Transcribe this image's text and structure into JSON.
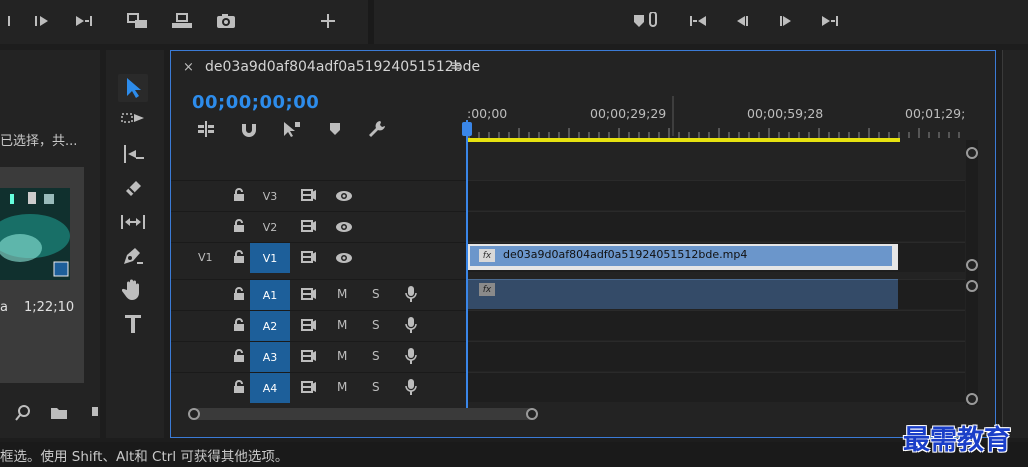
{
  "sequence": {
    "tab_title": "de03a9d0af804adf0a51924051512bde",
    "tab_close": "×",
    "tab_menu": "≡",
    "timecode": "00;00;00;00",
    "ruler_labels": [
      ":00;00",
      "00;00;29;29",
      "00;00;59;28",
      "00;01;29;"
    ]
  },
  "project": {
    "truncated_text": "已选择，共...",
    "clip_name": "a",
    "clip_duration": "1;22;10"
  },
  "tracks": {
    "video": [
      {
        "label": "V3",
        "source": ""
      },
      {
        "label": "V2",
        "source": ""
      },
      {
        "label": "V1",
        "source": "V1"
      }
    ],
    "audio": [
      {
        "label": "A1",
        "m": "M",
        "s": "S"
      },
      {
        "label": "A2",
        "m": "M",
        "s": "S"
      },
      {
        "label": "A3",
        "m": "M",
        "s": "S"
      },
      {
        "label": "A4",
        "m": "M",
        "s": "S"
      }
    ]
  },
  "clips": {
    "video_clip_name": "de03a9d0af804adf0a51924051512bde.mp4",
    "fx_label": "fx"
  },
  "status_bar": {
    "text": "框选。使用 Shift、Alt和 Ctrl 可获得其他选项。"
  },
  "watermark": "最需教育",
  "colors": {
    "accent": "#2d8ceb",
    "target_track": "#1d5f9a",
    "work_area": "#e6e210",
    "video_clip": "#6b96cb",
    "audio_clip": "#344b68"
  }
}
